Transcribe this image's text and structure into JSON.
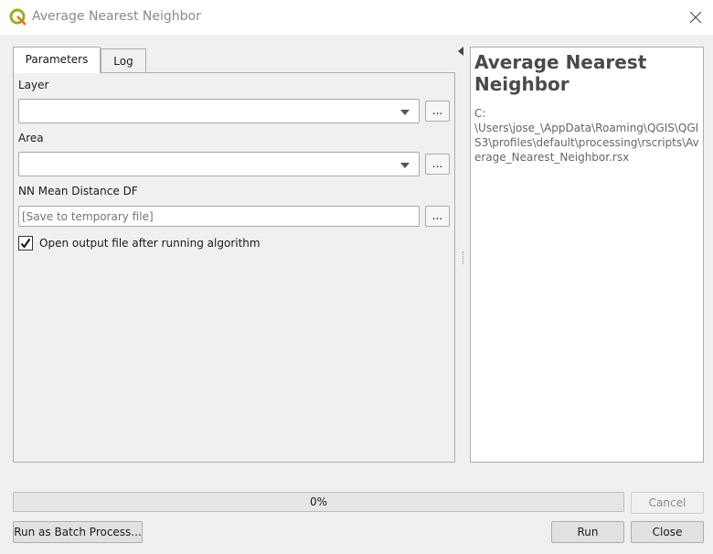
{
  "window": {
    "title": "Average Nearest Neighbor",
    "app_icon": "qgis-logo-icon",
    "close_icon": "close-icon"
  },
  "tabs": [
    {
      "label": "Parameters",
      "active": true
    },
    {
      "label": "Log",
      "active": false
    }
  ],
  "parameters": {
    "layer": {
      "label": "Layer",
      "value": "",
      "browse_label": "..."
    },
    "area": {
      "label": "Area",
      "value": "",
      "browse_label": "..."
    },
    "output": {
      "label": "NN Mean Distance DF",
      "placeholder": "[Save to temporary file]",
      "browse_label": "..."
    },
    "open_output": {
      "label": "Open output file after running algorithm",
      "checked": true
    }
  },
  "help": {
    "title": "Average Nearest Neighbor",
    "path": "C:\n\\Users\\jose_\\AppData\\Roaming\\QGIS\\QGIS3\\profiles\\default\\processing\\rscripts\\Average_Nearest_Neighbor.rsx"
  },
  "progress": {
    "value": 0,
    "label": "0%"
  },
  "buttons": {
    "cancel": "Cancel",
    "batch": "Run as Batch Process...",
    "run": "Run",
    "close": "Close"
  },
  "colors": {
    "progress_fill": "#06b025",
    "logo_green": "#93b023"
  }
}
